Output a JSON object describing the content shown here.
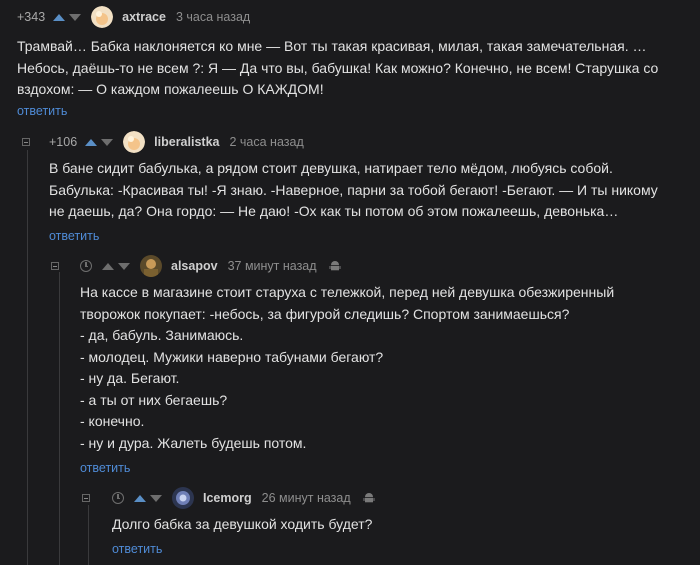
{
  "comments": [
    {
      "rating": "+343",
      "username": "axtrace",
      "time": "3 часа назад",
      "lines": [
        "Трамвай… Бабка наклоняется ко мне — Вот ты такая красивая, милая, такая замечательная. …",
        "Небось, даёшь-то не всем ?: Я — Да что вы, бабушка! Как можно? Конечно, не всем! Старушка со",
        "вздохом: — О каждом пожалеешь О КАЖДОМ!"
      ],
      "reply": "ответить"
    },
    {
      "rating": "+106",
      "username": "liberalistka",
      "time": "2 часа назад",
      "lines": [
        "В бане сидит бабулька, а рядом стоит девушка, натирает тело мёдом, любуясь собой.",
        "Бабулька: -Красивая ты! -Я знаю. -Наверное, парни за тобой бегают! -Бегают. — И ты никому",
        "не даешь, да? Она гордо: — Не даю! -Ох как ты потом об этом пожалеешь, девонька…"
      ],
      "reply": "ответить"
    },
    {
      "username": "alsapov",
      "time": "37 минут назад",
      "lines": [
        "На кассе в магазине стоит старуха с тележкой, перед ней девушка обезжиренный",
        "творожок покупает: -небось, за фигурой следишь? Спортом занимаешься?",
        "- да, бабуль. Занимаюсь.",
        "- молодец. Мужики наверно табунами бегают?",
        "- ну да. Бегают.",
        "- а ты от них бегаешь?",
        "- конечно.",
        "- ну и дура. Жалеть будешь потом."
      ],
      "reply": "ответить"
    },
    {
      "username": "Icemorg",
      "time": "26 минут назад",
      "lines": [
        "Долго бабка за девушкой ходить будет?"
      ],
      "reply": "ответить"
    }
  ],
  "colors": {
    "background": "#1b1b1d",
    "accent": "#4f8bd6",
    "upvote": "#5a8fc6"
  }
}
